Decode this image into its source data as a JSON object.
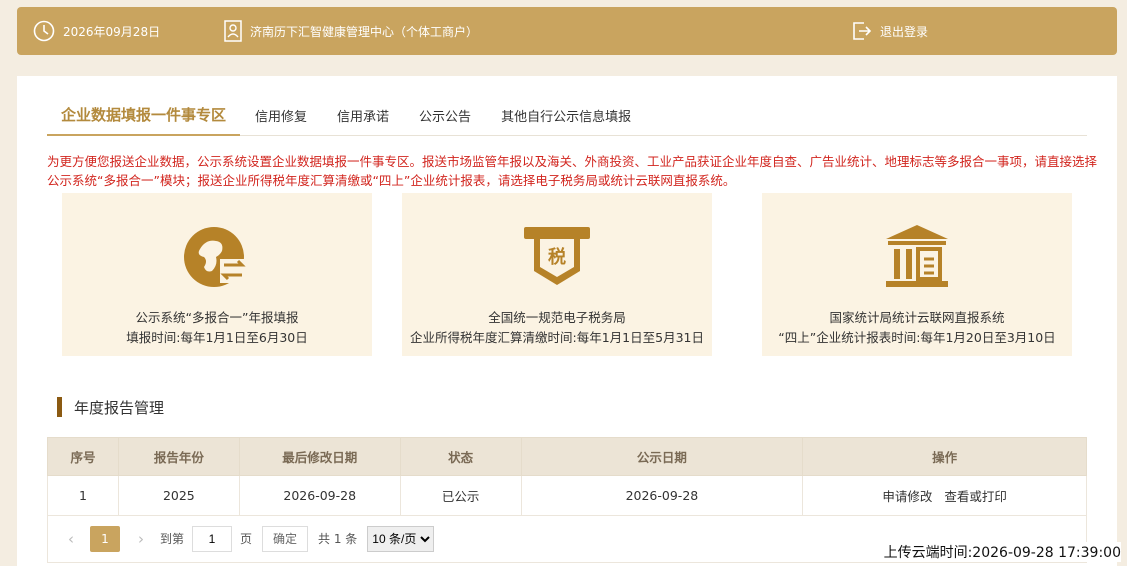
{
  "header": {
    "date": "2026年09月28日",
    "org": "济南历下汇智健康管理中心（个体工商户）",
    "logout_label": "退出登录"
  },
  "tabs": [
    {
      "label": "企业数据填报一件事专区",
      "active": true
    },
    {
      "label": "信用修复"
    },
    {
      "label": "信用承诺"
    },
    {
      "label": "公示公告"
    },
    {
      "label": "其他自行公示信息填报"
    }
  ],
  "notice": "为更方便您报送企业数据，公示系统设置企业数据填报一件事专区。报送市场监管年报以及海关、外商投资、工业产品获证企业年度自查、广告业统计、地理标志等多报合一事项，请直接选择公示系统“多报合一”模块；报送企业所得税年度汇算清缴或“四上”企业统计报表，请选择电子税务局或统计云联网直报系统。",
  "cards": [
    {
      "icon": "public-system-icon",
      "line1": "公示系统“多报合一”年报填报",
      "line2": "填报时间:每年1月1日至6月30日"
    },
    {
      "icon": "tax-icon",
      "icon_text": "税",
      "line1": "全国统一规范电子税务局",
      "line2": "企业所得税年度汇算清缴时间:每年1月1日至5月31日"
    },
    {
      "icon": "statistics-bureau-icon",
      "line1": "国家统计局统计云联网直报系统",
      "line2": "“四上”企业统计报表时间:每年1月20日至3月10日"
    }
  ],
  "section": {
    "title": "年度报告管理"
  },
  "table": {
    "headers": [
      "序号",
      "报告年份",
      "最后修改日期",
      "状态",
      "公示日期",
      "操作"
    ],
    "rows": [
      {
        "no": "1",
        "year": "2025",
        "modified": "2026-09-28",
        "status": "已公示",
        "public_date": "2026-09-28",
        "op1": "申请修改",
        "op2": "查看或打印"
      }
    ]
  },
  "pager": {
    "current_page": "1",
    "goto_label": "到第",
    "goto_value": "1",
    "page_unit": "页",
    "confirm_label": "确定",
    "total": "共 1 条",
    "page_size": "10 条/页"
  },
  "upload_time": "上传云端时间:2026-09-28 17:39:00",
  "colors": {
    "accent": "#c9a45f",
    "notice": "#d2261f",
    "card_bg": "#fbf3e3"
  }
}
